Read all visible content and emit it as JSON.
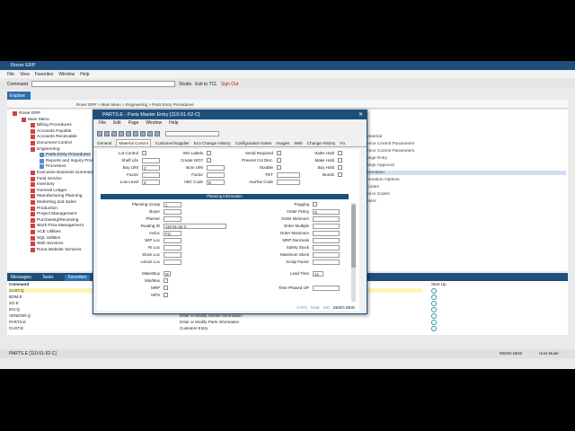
{
  "app": {
    "title": "Rover ERP"
  },
  "menu": [
    "File",
    "View",
    "Favorites",
    "Window",
    "Help"
  ],
  "cmdbar": {
    "label": "Command",
    "studio": "Studio",
    "exit": "Exit to TCL",
    "signout": "Sign Out"
  },
  "explorer_tab": "Explore",
  "breadcrumb": "Rover ERP  >  Main Menu  >  Engineering  >  Parts Entry Procedures",
  "tree": [
    {
      "label": "Rover ERP",
      "level": 0
    },
    {
      "label": "Main Menu",
      "level": 1
    },
    {
      "label": "Billing Procedures",
      "level": 2
    },
    {
      "label": "Accounts Payable",
      "level": 2
    },
    {
      "label": "Accounts Receivable",
      "level": 2
    },
    {
      "label": "Document Control",
      "level": 2
    },
    {
      "label": "Engineering",
      "level": 2
    },
    {
      "label": "Parts Entry Procedures",
      "level": 3,
      "selected": true
    },
    {
      "label": "Reports and Inquiry Procedures",
      "level": 3
    },
    {
      "label": "Processes",
      "level": 3
    },
    {
      "label": "Executive Business Summary",
      "level": 2
    },
    {
      "label": "Field Service",
      "level": 2
    },
    {
      "label": "Inventory",
      "level": 2
    },
    {
      "label": "General Ledger",
      "level": 2
    },
    {
      "label": "Manufacturing Planning",
      "level": 2
    },
    {
      "label": "Marketing and Sales",
      "level": 2
    },
    {
      "label": "Production",
      "level": 2
    },
    {
      "label": "Project Management",
      "level": 2
    },
    {
      "label": "Purchasing/Receiving",
      "level": 2
    },
    {
      "label": "Work Flow Management",
      "level": 2
    },
    {
      "label": "ACE Utilities",
      "level": 2
    },
    {
      "label": "SQL Utilities",
      "level": 2
    },
    {
      "label": "Web Services",
      "level": 2
    },
    {
      "label": "Rova Website Services",
      "level": 2
    }
  ],
  "right_items": [
    {
      "label": "Material",
      "hl": false
    },
    {
      "label": "ence Control Parameters",
      "hl": false
    },
    {
      "label": "ence Control Parameters",
      "hl": false
    },
    {
      "label": "ange Entry",
      "hl": false
    },
    {
      "label": "ange Approval",
      "hl": false
    },
    {
      "label": "formation",
      "hl": true
    },
    {
      "label": "ormation Options",
      "hl": false
    },
    {
      "label": "Codes",
      "hl": false
    },
    {
      "label": "ence Codes",
      "hl": false
    },
    {
      "label": "eters",
      "hl": false
    }
  ],
  "msgtabs": [
    "Messages",
    "Tasks",
    "Favorites"
  ],
  "msg_header": {
    "command": "Command",
    "startup": "Start Up"
  },
  "messages": [
    {
      "cmd": "CUST.Q",
      "desc": "",
      "hl": true
    },
    {
      "cmd": "BOM.E",
      "desc": "",
      "hl": false
    },
    {
      "cmd": "SO.E",
      "desc": "",
      "hl": false
    },
    {
      "cmd": "INV.Q",
      "desc": "",
      "hl": false
    },
    {
      "cmd": "VENDOR.Q",
      "desc": "Enter or Modify Vendor Information",
      "hl": false
    },
    {
      "cmd": "PARTS.E",
      "desc": "Enter or Modify Parts Information",
      "hl": false
    },
    {
      "cmd": "CUST.E",
      "desc": "Customer Entry",
      "hl": false
    }
  ],
  "status": {
    "left": "PARTS.E [110-51-52-C]",
    "demo": "DEMO.NEW",
    "mode": "Host Mode"
  },
  "dialog": {
    "title": "PARTS.E - Parts Master Entry [110-51-52-C]",
    "menu": [
      "File",
      "Edit",
      "Page",
      "Window",
      "Help"
    ],
    "tabs": [
      "General",
      "Material Control",
      "Customer/Supplier",
      "Eco Change History",
      "Configuration Notes",
      "Images",
      "Web",
      "Change History",
      "Fa"
    ],
    "active_tab": 1,
    "section_title": "Planning Information",
    "col1": [
      {
        "label": "Lot Control",
        "type": "chk"
      },
      {
        "label": "Shelf Life",
        "type": "fld",
        "value": ""
      },
      {
        "label": "Buy U/M",
        "type": "fld",
        "value": "C"
      },
      {
        "label": "Factor",
        "type": "fld",
        "value": ""
      },
      {
        "label": "Low Level",
        "type": "fld",
        "value": "3"
      }
    ],
    "col2": [
      {
        "label": "WO Labels",
        "type": "chk"
      },
      {
        "label": "Create WO?",
        "type": "chk"
      },
      {
        "label": "Bom U/M",
        "type": "fld",
        "value": ""
      },
      {
        "label": "Factor",
        "type": "fld",
        "value": ""
      },
      {
        "label": "ABC Code",
        "type": "fld",
        "value": "B"
      }
    ],
    "col3": [
      {
        "label": "Serial Required",
        "type": "chk"
      },
      {
        "label": "Prevent Cst Disc.",
        "type": "chk"
      },
      {
        "label": "Taxable",
        "type": "chk"
      },
      {
        "label": "FET",
        "type": "fld",
        "value": ""
      },
      {
        "label": "AvaTax Code",
        "type": "fld",
        "value": ""
      }
    ],
    "col4": [
      {
        "label": "Sales Hold"
      },
      {
        "label": "Make Hold"
      },
      {
        "label": "Buy Hold"
      },
      {
        "label": "Bonds"
      }
    ],
    "plan_left": [
      {
        "label": "Planning Group",
        "value": "1"
      },
      {
        "label": "Buyer",
        "value": ""
      },
      {
        "label": "Planner",
        "value": ""
      },
      {
        "label": "Routing ID",
        "value": "110-51-52-C"
      },
      {
        "label": "Invloc",
        "value": "FG"
      },
      {
        "label": "WIP Loc",
        "value": ""
      },
      {
        "label": "RI Loc",
        "value": ""
      },
      {
        "label": "Stock Loc",
        "value": ""
      },
      {
        "label": "Lstock Loc",
        "value": ""
      }
    ],
    "plan_right": [
      {
        "label": "Pegging",
        "value": "",
        "type": "chk"
      },
      {
        "label": "Order Policy",
        "value": "D",
        "type": "fld"
      },
      {
        "label": "Order Minimum",
        "value": "",
        "type": "fld"
      },
      {
        "label": "Order Multiple",
        "value": "",
        "type": "fld"
      },
      {
        "label": "Order Maximum",
        "value": "",
        "type": "fld"
      },
      {
        "label": "MRP Decimals",
        "value": "",
        "type": "fld"
      },
      {
        "label": "Safety Stock",
        "value": "",
        "type": "fld"
      },
      {
        "label": "Maximum Stock",
        "value": "",
        "type": "fld"
      },
      {
        "label": "Scrap Factor",
        "value": "",
        "type": "fld"
      }
    ],
    "bottom_left": [
      {
        "label": "Make/Buy",
        "value": "M",
        "type": "fld"
      },
      {
        "label": "Min/Max",
        "value": "",
        "type": "chk"
      },
      {
        "label": "MRP",
        "value": "",
        "type": "chk"
      },
      {
        "label": "MPS",
        "value": "",
        "type": "chk"
      }
    ],
    "bottom_right": [
      {
        "label": "Lead Time",
        "value": "14"
      },
      {
        "label": "Time Phased OP",
        "value": ""
      }
    ],
    "status": [
      "CAPS",
      "NUM",
      "INS",
      "DEMO.NEW"
    ]
  }
}
